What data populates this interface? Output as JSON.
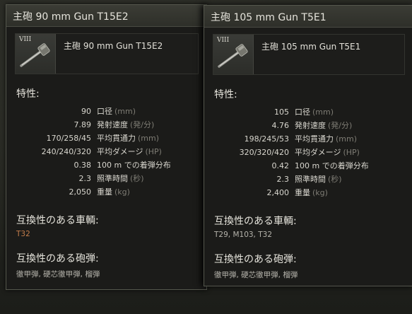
{
  "panels": [
    {
      "title": "主砲 90 mm Gun T15E2",
      "gun_name": "主砲 90 mm Gun T15E2",
      "tier": "VIII",
      "section_specs": "特性:",
      "specs": [
        {
          "value": "90",
          "label": "口径",
          "unit": "(mm)"
        },
        {
          "value": "7.89",
          "label": "発射速度",
          "unit": "(発/分)"
        },
        {
          "value": "170/258/45",
          "label": "平均貫通力",
          "unit": "(mm)"
        },
        {
          "value": "240/240/320",
          "label": "平均ダメージ",
          "unit": "(HP)"
        },
        {
          "value": "0.38",
          "label": "100 m での着弾分布",
          "unit": ""
        },
        {
          "value": "2.3",
          "label": "照準時間",
          "unit": "(秒)"
        },
        {
          "value": "2,050",
          "label": "重量",
          "unit": "(kg)"
        }
      ],
      "section_vehicles": "互換性のある車輌:",
      "vehicles": "T32",
      "section_ammo": "互換性のある砲弾:",
      "ammo": "徹甲弾, 硬芯徹甲弾, 榴弾"
    },
    {
      "title": "主砲 105 mm Gun T5E1",
      "gun_name": "主砲 105 mm Gun T5E1",
      "tier": "VIII",
      "section_specs": "特性:",
      "specs": [
        {
          "value": "105",
          "label": "口径",
          "unit": "(mm)"
        },
        {
          "value": "4.76",
          "label": "発射速度",
          "unit": "(発/分)"
        },
        {
          "value": "198/245/53",
          "label": "平均貫通力",
          "unit": "(mm)"
        },
        {
          "value": "320/320/420",
          "label": "平均ダメージ",
          "unit": "(HP)"
        },
        {
          "value": "0.42",
          "label": "100 m での着弾分布",
          "unit": ""
        },
        {
          "value": "2.3",
          "label": "照準時間",
          "unit": "(秒)"
        },
        {
          "value": "2,400",
          "label": "重量",
          "unit": "(kg)"
        }
      ],
      "section_vehicles": "互換性のある車輌:",
      "vehicles": "T29, M103, T32",
      "section_ammo": "互換性のある砲弾:",
      "ammo": "徹甲弾, 硬芯徹甲弾, 榴弾"
    }
  ],
  "colors": {
    "vehicles_highlight": "#c27c4a",
    "text": "#d8d6ce",
    "unit": "#7e7c74"
  },
  "icons": {
    "gun": "gun-icon"
  }
}
